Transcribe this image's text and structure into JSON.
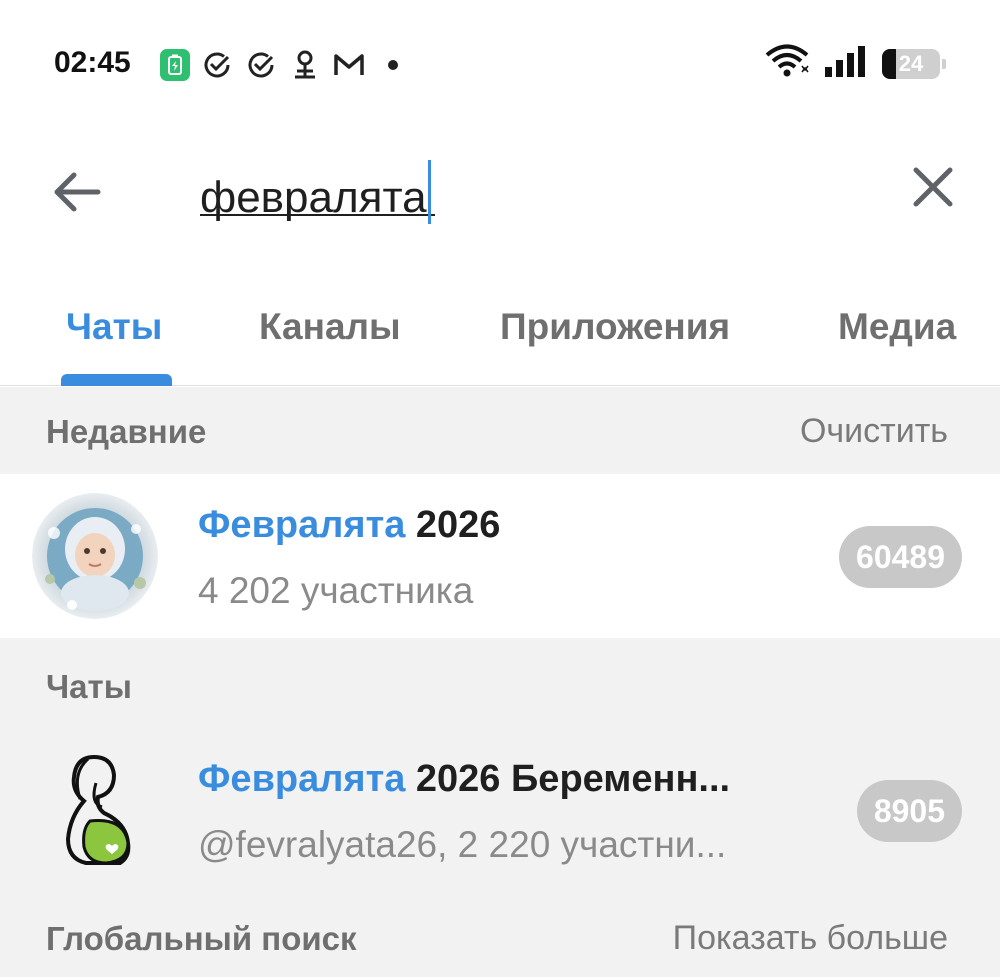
{
  "status_bar": {
    "time": "02:45",
    "battery_percent": "24",
    "icons": [
      "battery-charging-icon",
      "check-circle-icon",
      "check-circle-icon",
      "tree-icon",
      "mail-m-icon",
      "dot-icon",
      "wifi-icon",
      "signal-icon",
      "battery-icon"
    ]
  },
  "search": {
    "query": "февралята"
  },
  "tabs": [
    {
      "label": "Чаты",
      "active": true
    },
    {
      "label": "Каналы",
      "active": false
    },
    {
      "label": "Приложения",
      "active": false
    },
    {
      "label": "Медиа",
      "active": false
    }
  ],
  "recent": {
    "title": "Недавние",
    "action": "Очистить",
    "item": {
      "title_highlight": "Февралята",
      "title_rest": " 2026",
      "subtitle": "4 202 участника",
      "badge": "60489"
    }
  },
  "chats": {
    "title": "Чаты",
    "item": {
      "title_highlight": "Февралята",
      "title_rest": " 2026 Беременн...",
      "subtitle": "@fevralyata26, 2 220 участни...",
      "badge": "8905"
    }
  },
  "global": {
    "title": "Глобальный поиск",
    "action": "Показать больше"
  },
  "colors": {
    "accent": "#3a8dde",
    "badge": "#c8c8c8",
    "section_bg": "#f2f2f2"
  }
}
